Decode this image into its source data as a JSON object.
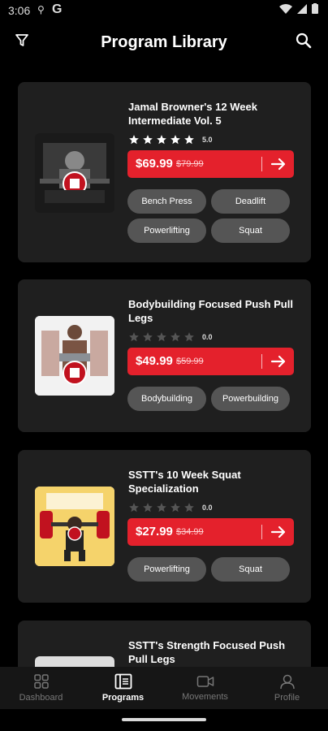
{
  "status": {
    "time": "3:06",
    "g": "G"
  },
  "header": {
    "title": "Program Library"
  },
  "programs": [
    {
      "title": "Jamal Browner's 12 Week Intermediate Vol. 5",
      "rating": "5.0",
      "stars": 5,
      "price": "$69.99",
      "old_price": "$79.99",
      "tags": [
        "Bench Press",
        "Deadlift",
        "Powerlifting",
        "Squat"
      ]
    },
    {
      "title": "Bodybuilding Focused Push Pull Legs",
      "rating": "0.0",
      "stars": 0,
      "price": "$49.99",
      "old_price": "$59.99",
      "tags": [
        "Bodybuilding",
        "Powerbuilding"
      ]
    },
    {
      "title": "SSTT's 10 Week Squat Specialization",
      "rating": "0.0",
      "stars": 0,
      "price": "$27.99",
      "old_price": "$34.99",
      "tags": [
        "Powerlifting",
        "Squat"
      ]
    },
    {
      "title": "SSTT's Strength Focused Push Pull Legs"
    }
  ],
  "nav": [
    {
      "label": "Dashboard",
      "icon": "grid-icon",
      "active": false
    },
    {
      "label": "Programs",
      "icon": "book-icon",
      "active": true
    },
    {
      "label": "Movements",
      "icon": "video-icon",
      "active": false
    },
    {
      "label": "Profile",
      "icon": "person-icon",
      "active": false
    }
  ],
  "colors": {
    "accent": "#e4212c",
    "card": "#1f1f1f",
    "tag": "#555555"
  }
}
